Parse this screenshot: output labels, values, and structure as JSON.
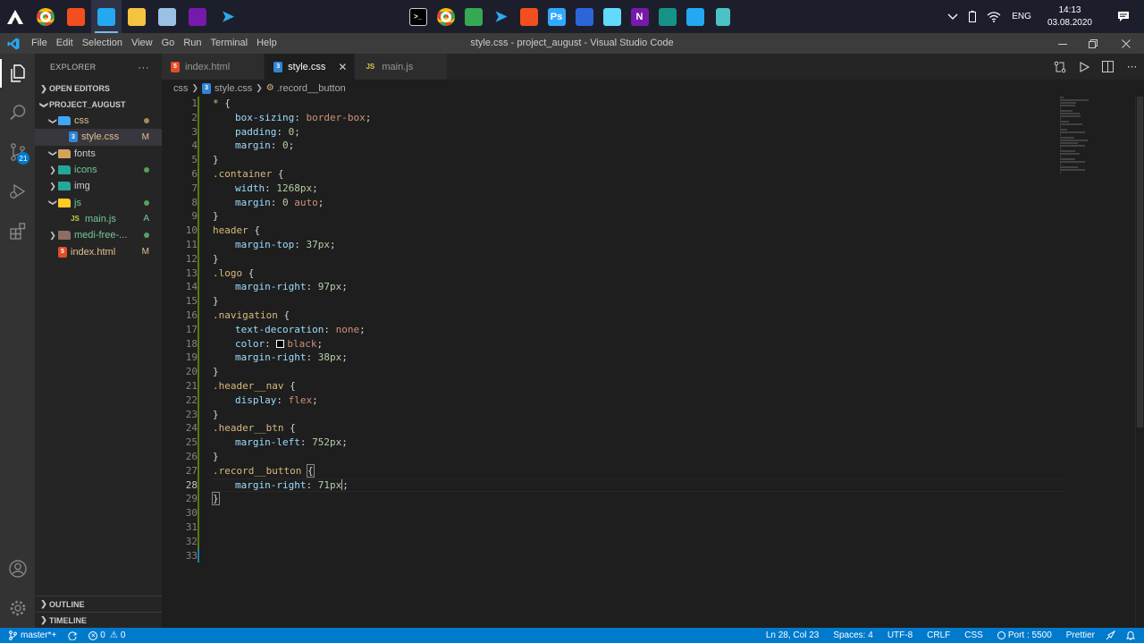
{
  "taskbar": {
    "pinned_left": [
      {
        "name": "chrome",
        "color": "#4285f4"
      },
      {
        "name": "figma",
        "color": "#f24e1e"
      },
      {
        "name": "vscode",
        "color": "#23a9f2"
      },
      {
        "name": "file-explorer",
        "color": "#f5c342"
      },
      {
        "name": "notepad",
        "color": "#9bc0e6"
      },
      {
        "name": "onenote",
        "color": "#7719aa"
      },
      {
        "name": "telegram-web",
        "color": "#2aabee"
      }
    ],
    "pinned_center": [
      {
        "name": "terminal",
        "color": "#000000",
        "glyph": ">_"
      },
      {
        "name": "chrome",
        "color": "#4285f4"
      },
      {
        "name": "grid-app",
        "color": "#35a853"
      },
      {
        "name": "telegram",
        "color": "#2aabee"
      },
      {
        "name": "figma",
        "color": "#f24e1e"
      },
      {
        "name": "photoshop",
        "color": "#31a8ff",
        "glyph": "Ps"
      },
      {
        "name": "sourcetree",
        "color": "#2b65d9"
      },
      {
        "name": "react-atom",
        "color": "#61dafb"
      },
      {
        "name": "onenote",
        "color": "#7719aa",
        "glyph": "N"
      },
      {
        "name": "gitkraken",
        "color": "#179287"
      },
      {
        "name": "vscode",
        "color": "#23a9f2"
      },
      {
        "name": "sticky-notes",
        "color": "#4cc2c4"
      }
    ],
    "language": "ENG",
    "time": "14:13",
    "date": "03.08.2020"
  },
  "titlebar": {
    "menu": [
      "File",
      "Edit",
      "Selection",
      "View",
      "Go",
      "Run",
      "Terminal",
      "Help"
    ],
    "title": "style.css - project_august - Visual Studio Code"
  },
  "activitybar": {
    "scm_badge": "21"
  },
  "sidebar": {
    "header": "EXPLORER",
    "more": "···",
    "open_editors": "OPEN EDITORS",
    "project": "PROJECT_AUGUST",
    "tree": [
      {
        "label": "css",
        "type": "folder",
        "open": true,
        "depth": 1,
        "status": "dot",
        "status_color": "#a58a5c",
        "label_color": "#e2c08d",
        "icon_color": "#42a5f5"
      },
      {
        "label": "style.css",
        "type": "css",
        "depth": 2,
        "status": "M",
        "status_color": "#e2c08d",
        "label_color": "#e2c08d",
        "selected": true
      },
      {
        "label": "fonts",
        "type": "folder",
        "open": true,
        "depth": 1,
        "status": "",
        "label_color": "#cccccc",
        "icon_color": "#d4a35a"
      },
      {
        "label": "icons",
        "type": "folder",
        "open": false,
        "depth": 1,
        "status": "dot",
        "status_color": "#5a9e5a",
        "label_color": "#73c991",
        "icon_color": "#26a69a"
      },
      {
        "label": "img",
        "type": "folder",
        "open": false,
        "depth": 1,
        "status": "",
        "label_color": "#cccccc",
        "icon_color": "#26a69a"
      },
      {
        "label": "js",
        "type": "folder",
        "open": true,
        "depth": 1,
        "status": "dot",
        "status_color": "#5a9e5a",
        "label_color": "#73c991",
        "icon_color": "#ffca28"
      },
      {
        "label": "main.js",
        "type": "js",
        "depth": 2,
        "status": "A",
        "status_color": "#73c991",
        "label_color": "#73c991"
      },
      {
        "label": "medi-free-...",
        "type": "folder",
        "open": false,
        "depth": 1,
        "status": "dot",
        "status_color": "#5a9e5a",
        "label_color": "#73c991",
        "icon_color": "#8d6e63"
      },
      {
        "label": "index.html",
        "type": "html",
        "depth": 1,
        "status": "M",
        "status_color": "#e2c08d",
        "label_color": "#e2c08d"
      }
    ],
    "outline": "OUTLINE",
    "timeline": "TIMELINE"
  },
  "tabs": [
    {
      "label": "index.html",
      "type": "html",
      "active": false
    },
    {
      "label": "style.css",
      "type": "css",
      "active": true
    },
    {
      "label": "main.js",
      "type": "js",
      "active": false
    }
  ],
  "breadcrumb": [
    "css",
    "style.css",
    ".record__button"
  ],
  "editor": {
    "current_line": 28,
    "lines": [
      [
        {
          "t": "sel",
          "v": "*"
        },
        {
          "t": "punc",
          "v": " {"
        }
      ],
      [
        {
          "t": "indent"
        },
        {
          "t": "prop",
          "v": "box-sizing"
        },
        {
          "t": "punc",
          "v": ": "
        },
        {
          "t": "val",
          "v": "border-box"
        },
        {
          "t": "punc",
          "v": ";"
        }
      ],
      [
        {
          "t": "indent"
        },
        {
          "t": "prop",
          "v": "padding"
        },
        {
          "t": "punc",
          "v": ": "
        },
        {
          "t": "num",
          "v": "0"
        },
        {
          "t": "punc",
          "v": ";"
        }
      ],
      [
        {
          "t": "indent"
        },
        {
          "t": "prop",
          "v": "margin"
        },
        {
          "t": "punc",
          "v": ": "
        },
        {
          "t": "num",
          "v": "0"
        },
        {
          "t": "punc",
          "v": ";"
        }
      ],
      [
        {
          "t": "punc",
          "v": "}"
        }
      ],
      [
        {
          "t": "sel",
          "v": ".container"
        },
        {
          "t": "punc",
          "v": " {"
        }
      ],
      [
        {
          "t": "indent"
        },
        {
          "t": "prop",
          "v": "width"
        },
        {
          "t": "punc",
          "v": ": "
        },
        {
          "t": "num",
          "v": "1268px"
        },
        {
          "t": "punc",
          "v": ";"
        }
      ],
      [
        {
          "t": "indent"
        },
        {
          "t": "prop",
          "v": "margin"
        },
        {
          "t": "punc",
          "v": ": "
        },
        {
          "t": "num",
          "v": "0"
        },
        {
          "t": "punc",
          "v": " "
        },
        {
          "t": "val",
          "v": "auto"
        },
        {
          "t": "punc",
          "v": ";"
        }
      ],
      [
        {
          "t": "punc",
          "v": "}"
        }
      ],
      [
        {
          "t": "sel",
          "v": "header"
        },
        {
          "t": "punc",
          "v": " {"
        }
      ],
      [
        {
          "t": "indent"
        },
        {
          "t": "prop",
          "v": "margin-top"
        },
        {
          "t": "punc",
          "v": ": "
        },
        {
          "t": "num",
          "v": "37px"
        },
        {
          "t": "punc",
          "v": ";"
        }
      ],
      [
        {
          "t": "punc",
          "v": "}"
        }
      ],
      [
        {
          "t": "sel",
          "v": ".logo"
        },
        {
          "t": "punc",
          "v": " {"
        }
      ],
      [
        {
          "t": "indent"
        },
        {
          "t": "prop",
          "v": "margin-right"
        },
        {
          "t": "punc",
          "v": ": "
        },
        {
          "t": "num",
          "v": "97px"
        },
        {
          "t": "punc",
          "v": ";"
        }
      ],
      [
        {
          "t": "punc",
          "v": "}"
        }
      ],
      [
        {
          "t": "sel",
          "v": ".navigation"
        },
        {
          "t": "punc",
          "v": " {"
        }
      ],
      [
        {
          "t": "indent"
        },
        {
          "t": "prop",
          "v": "text-decoration"
        },
        {
          "t": "punc",
          "v": ": "
        },
        {
          "t": "val",
          "v": "none"
        },
        {
          "t": "punc",
          "v": ";"
        }
      ],
      [
        {
          "t": "indent"
        },
        {
          "t": "prop",
          "v": "color"
        },
        {
          "t": "punc",
          "v": ": "
        },
        {
          "t": "swatch"
        },
        {
          "t": "val",
          "v": "black"
        },
        {
          "t": "punc",
          "v": ";"
        }
      ],
      [
        {
          "t": "indent"
        },
        {
          "t": "prop",
          "v": "margin-right"
        },
        {
          "t": "punc",
          "v": ": "
        },
        {
          "t": "num",
          "v": "38px"
        },
        {
          "t": "punc",
          "v": ";"
        }
      ],
      [
        {
          "t": "punc",
          "v": "}"
        }
      ],
      [
        {
          "t": "sel",
          "v": ".header__nav"
        },
        {
          "t": "punc",
          "v": " {"
        }
      ],
      [
        {
          "t": "indent"
        },
        {
          "t": "prop",
          "v": "display"
        },
        {
          "t": "punc",
          "v": ": "
        },
        {
          "t": "val",
          "v": "flex"
        },
        {
          "t": "punc",
          "v": ";"
        }
      ],
      [
        {
          "t": "punc",
          "v": "}"
        }
      ],
      [
        {
          "t": "sel",
          "v": ".header__btn"
        },
        {
          "t": "punc",
          "v": " {"
        }
      ],
      [
        {
          "t": "indent"
        },
        {
          "t": "prop",
          "v": "margin-left"
        },
        {
          "t": "punc",
          "v": ": "
        },
        {
          "t": "num",
          "v": "752px"
        },
        {
          "t": "punc",
          "v": ";"
        }
      ],
      [
        {
          "t": "punc",
          "v": "}"
        }
      ],
      [
        {
          "t": "sel",
          "v": ".record__button"
        },
        {
          "t": "punc",
          "v": " "
        },
        {
          "t": "bracehl",
          "v": "{"
        }
      ],
      [
        {
          "t": "indent"
        },
        {
          "t": "prop",
          "v": "margin-right"
        },
        {
          "t": "punc",
          "v": ": "
        },
        {
          "t": "num",
          "v": "71px"
        },
        {
          "t": "cursor"
        },
        {
          "t": "punc",
          "v": ";"
        }
      ],
      [
        {
          "t": "bracehl",
          "v": "}"
        }
      ],
      [],
      [],
      [],
      []
    ]
  },
  "statusbar": {
    "branch": "master*+",
    "errors": "0",
    "warnings": "0",
    "position": "Ln 28, Col 23",
    "spaces": "Spaces: 4",
    "encoding": "UTF-8",
    "eol": "CRLF",
    "language": "CSS",
    "port": "Port : 5500",
    "formatter": "Prettier"
  }
}
